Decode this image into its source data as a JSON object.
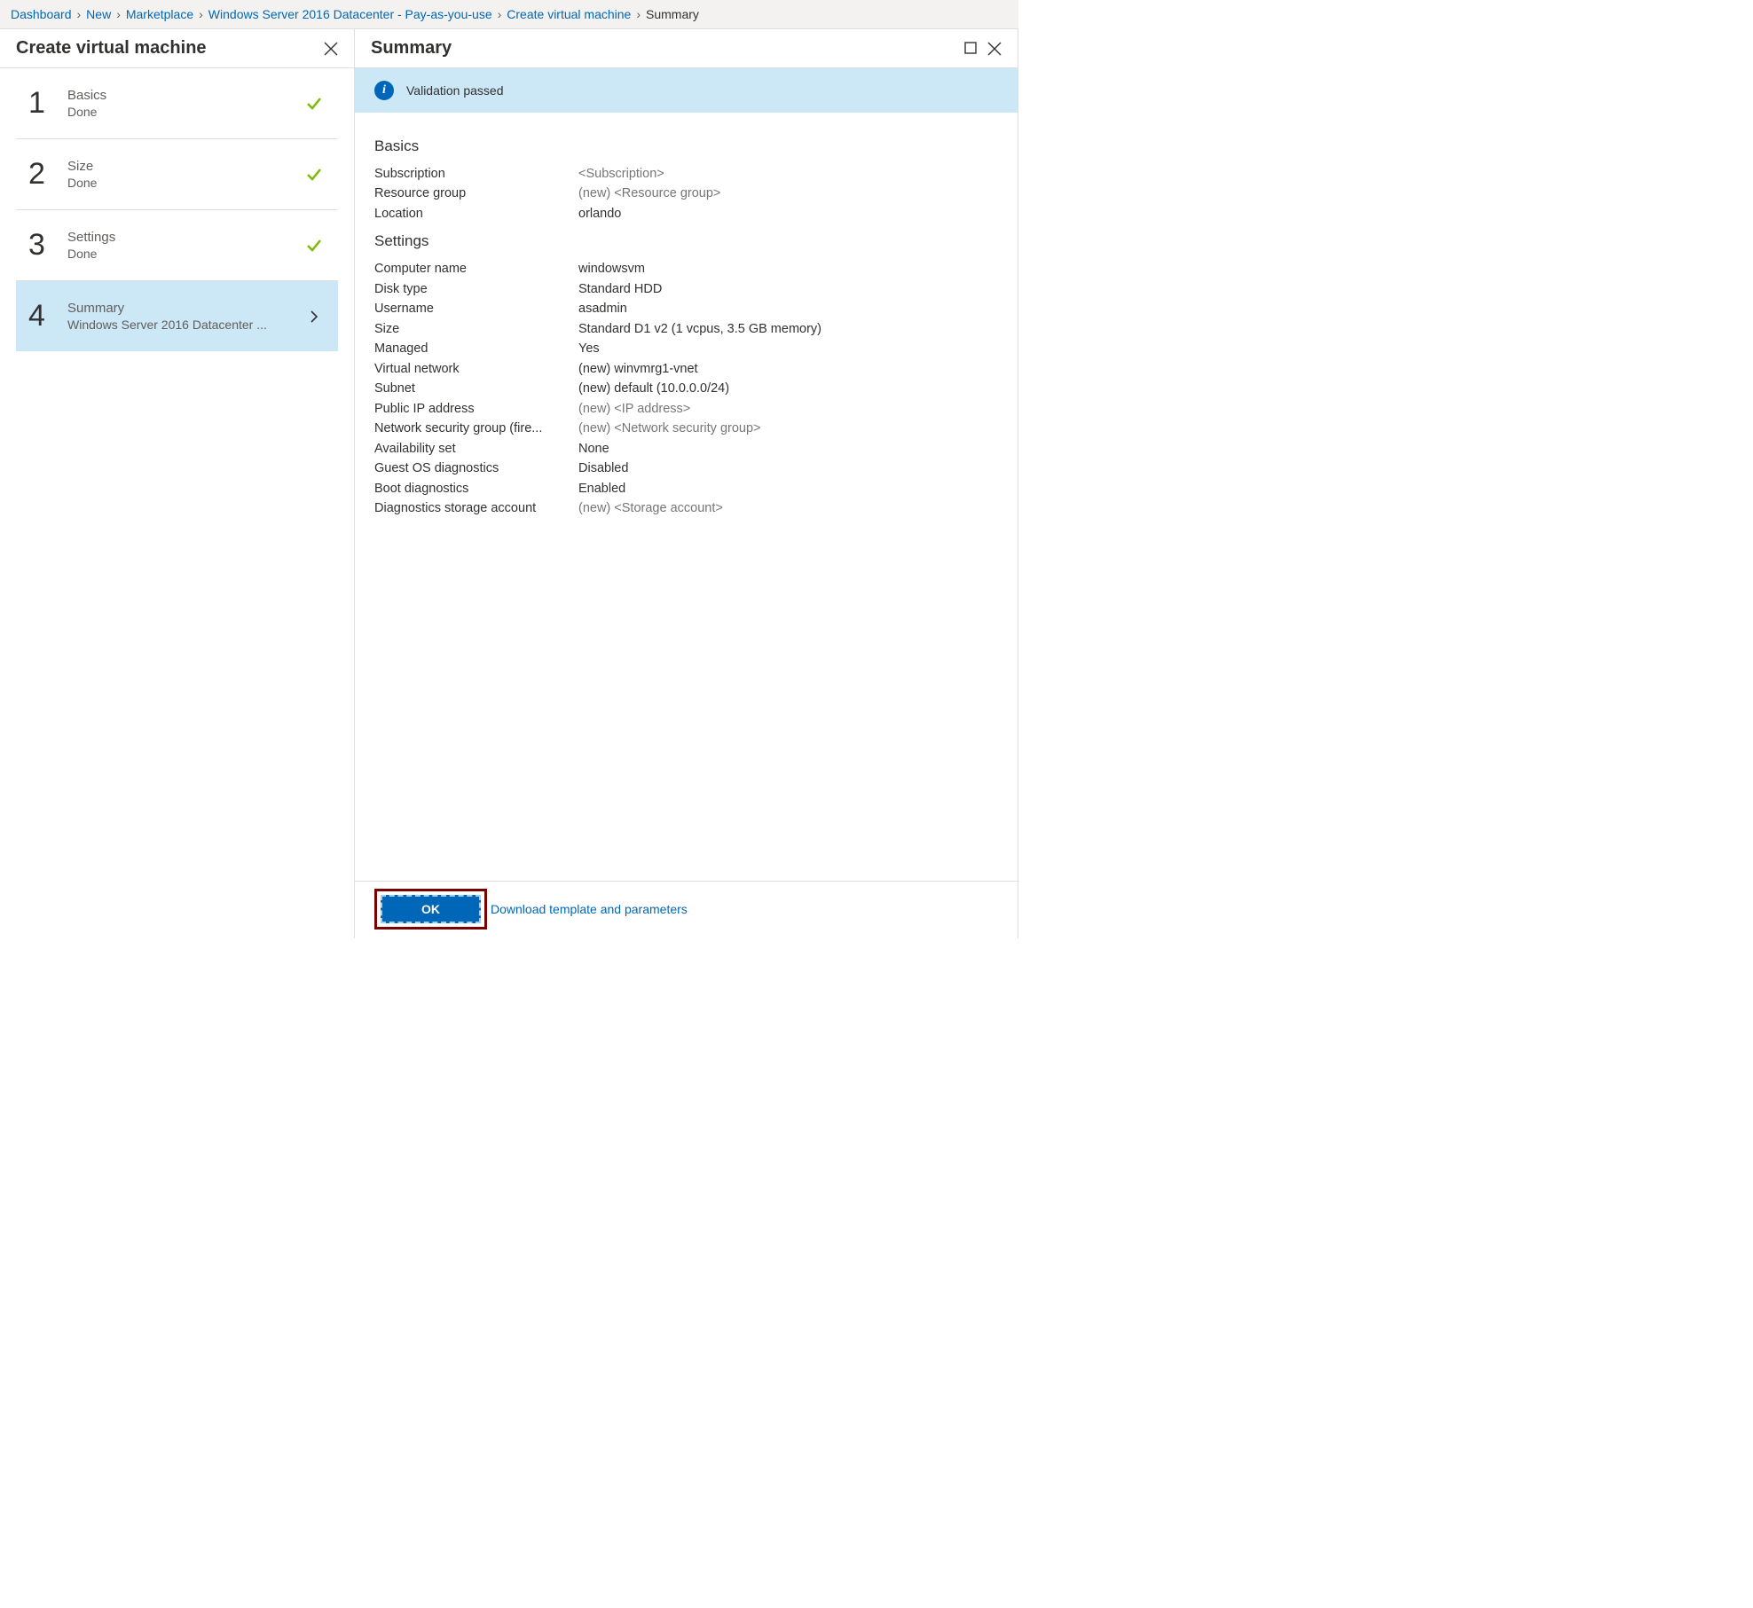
{
  "breadcrumb": {
    "items": [
      {
        "label": "Dashboard",
        "link": true
      },
      {
        "label": "New",
        "link": true
      },
      {
        "label": "Marketplace",
        "link": true
      },
      {
        "label": "Windows Server 2016 Datacenter - Pay-as-you-use",
        "link": true
      },
      {
        "label": "Create virtual machine",
        "link": true
      },
      {
        "label": "Summary",
        "link": false
      }
    ]
  },
  "left_pane": {
    "title": "Create virtual machine",
    "steps": [
      {
        "num": "1",
        "title": "Basics",
        "sub": "Done",
        "status": "done"
      },
      {
        "num": "2",
        "title": "Size",
        "sub": "Done",
        "status": "done"
      },
      {
        "num": "3",
        "title": "Settings",
        "sub": "Done",
        "status": "done"
      },
      {
        "num": "4",
        "title": "Summary",
        "sub": "Windows Server 2016 Datacenter ...",
        "status": "active"
      }
    ]
  },
  "right_pane": {
    "title": "Summary",
    "validation": "Validation passed",
    "sections": [
      {
        "title": "Basics",
        "rows": [
          {
            "label": "Subscription",
            "value": "<Subscription>",
            "muted": true
          },
          {
            "label": "Resource group",
            "value": "(new) <Resource group>",
            "muted": true
          },
          {
            "label": "Location",
            "value": "orlando"
          }
        ]
      },
      {
        "title": "Settings",
        "rows": [
          {
            "label": "Computer name",
            "value": "windowsvm"
          },
          {
            "label": "Disk type",
            "value": "Standard HDD"
          },
          {
            "label": "Username",
            "value": "asadmin"
          },
          {
            "label": "Size",
            "value": "Standard D1 v2 (1 vcpus, 3.5 GB memory)"
          },
          {
            "label": "Managed",
            "value": "Yes"
          },
          {
            "label": "Virtual network",
            "value": "(new) winvmrg1-vnet"
          },
          {
            "label": "Subnet",
            "value": "(new) default (10.0.0.0/24)"
          },
          {
            "label": "Public IP address",
            "value": "(new) <IP address>",
            "muted": true
          },
          {
            "label": "Network security group (fire...",
            "value": "(new) <Network security group>",
            "muted": true
          },
          {
            "label": "Availability set",
            "value": "None"
          },
          {
            "label": "Guest OS diagnostics",
            "value": "Disabled"
          },
          {
            "label": "Boot diagnostics",
            "value": "Enabled"
          },
          {
            "label": "Diagnostics storage account",
            "value": "(new) <Storage account>",
            "muted": true
          }
        ]
      }
    ],
    "footer": {
      "ok": "OK",
      "download": "Download template and parameters"
    }
  }
}
